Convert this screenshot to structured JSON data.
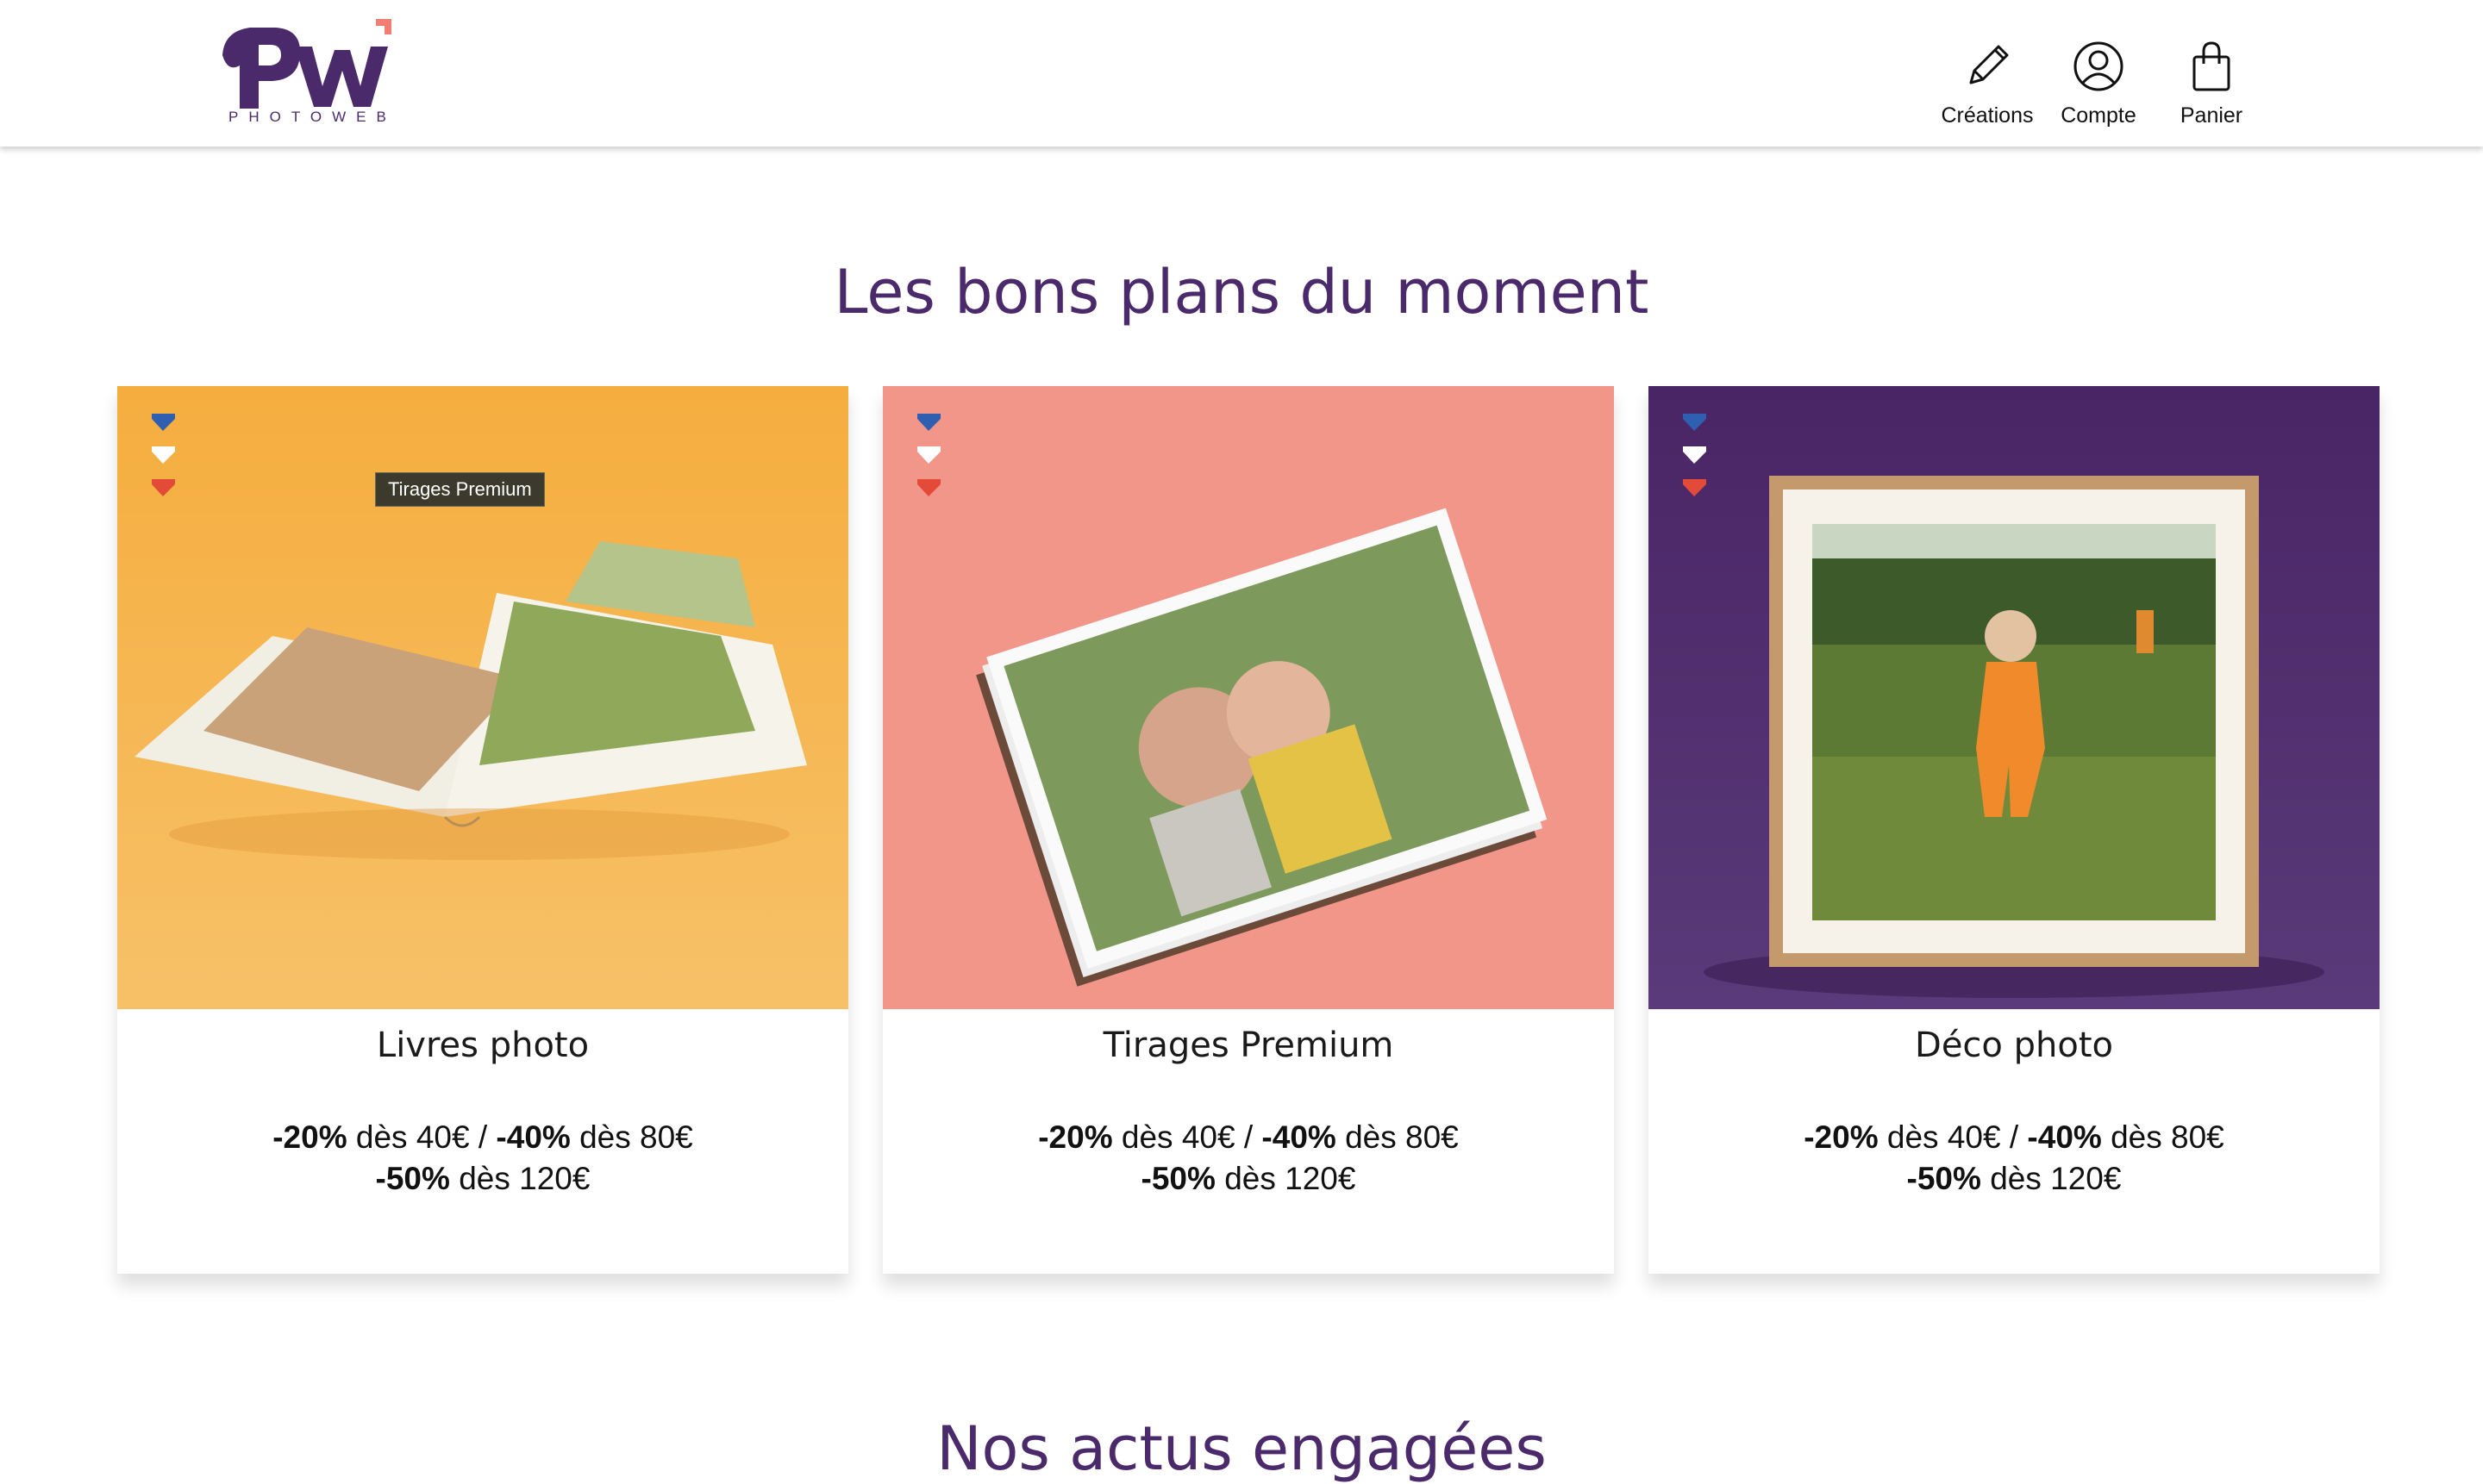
{
  "header": {
    "logo_text": "PHOTOWEB",
    "nav": [
      {
        "label": "Créations",
        "icon": "pencil-icon"
      },
      {
        "label": "Compte",
        "icon": "user-circle-icon"
      },
      {
        "label": "Panier",
        "icon": "shopping-bag-icon"
      }
    ]
  },
  "deals": {
    "title": "Les bons plans du moment",
    "tooltip": "Tirages Premium",
    "cards": [
      {
        "name": "Livres photo",
        "bg_color": "#f6b348",
        "image": "photo-book-image",
        "p1": "-20%",
        "t1": " dès 40€ / ",
        "p2": "-40%",
        "t2": " dès 80€",
        "p3": "-50%",
        "t3": " dès 120€"
      },
      {
        "name": "Tirages Premium",
        "bg_color": "#f3968a",
        "image": "photo-prints-image",
        "p1": "-20%",
        "t1": " dès 40€ / ",
        "p2": "-40%",
        "t2": " dès 80€",
        "p3": "-50%",
        "t3": " dès 120€"
      },
      {
        "name": "Déco photo",
        "bg_color": "#4e2a68",
        "image": "framed-photo-image",
        "p1": "-20%",
        "t1": " dès 40€ / ",
        "p2": "-40%",
        "t2": " dès 80€",
        "p3": "-50%",
        "t3": " dès 120€"
      }
    ]
  },
  "next_section": {
    "title": "Nos actus engagées"
  },
  "colors": {
    "brand_purple": "#4a2a6b",
    "brand_coral": "#f07f72",
    "flag_blue": "#2f5fb0",
    "flag_white": "#ffffff",
    "flag_red": "#e34b38"
  }
}
